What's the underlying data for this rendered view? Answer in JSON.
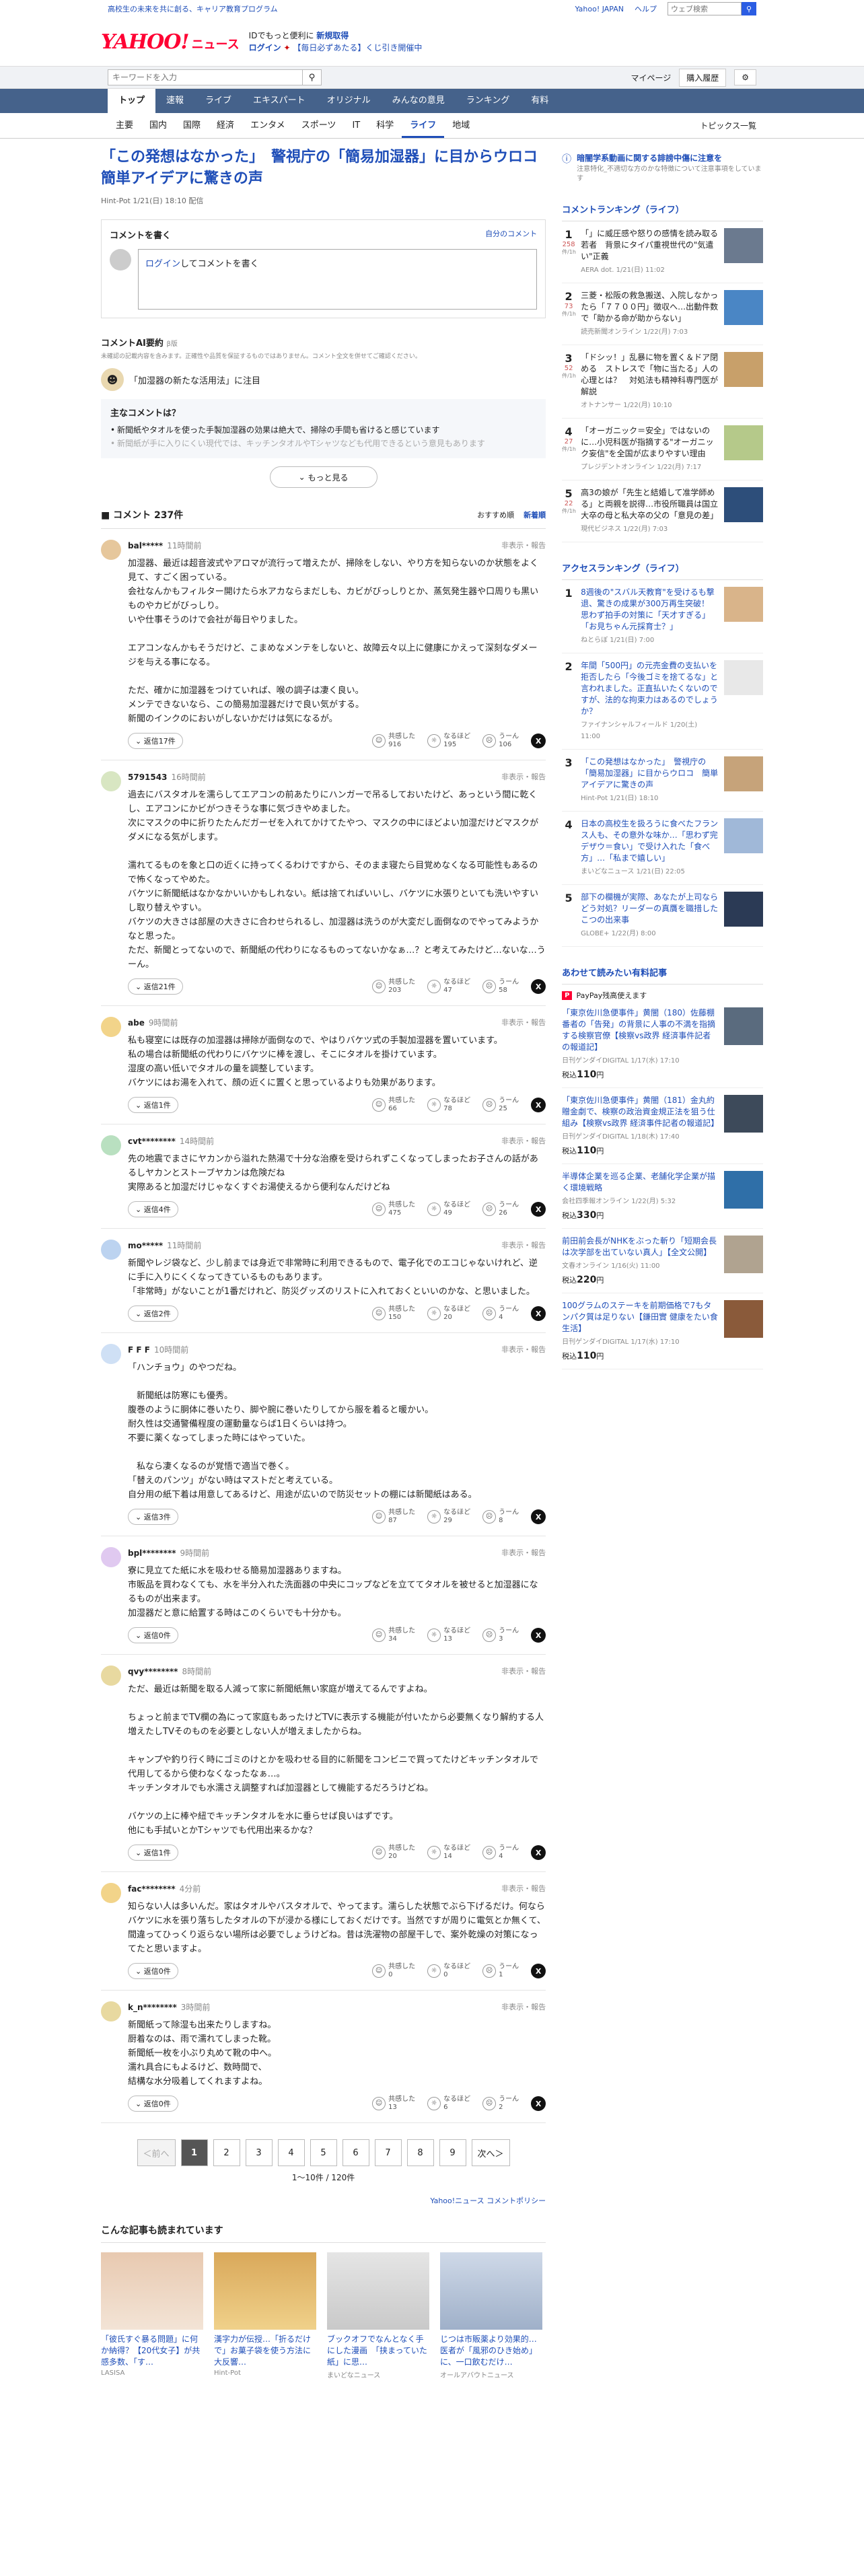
{
  "topstrip": {
    "left": "高校生の未来を共に創る、キャリア教育プログラム",
    "links": [
      "Yahoo! JAPAN",
      "ヘルプ"
    ],
    "search_placeholder": "ウェブ検索"
  },
  "brand": {
    "logo": "YAHOO!",
    "logo_sub": "JAPAN",
    "service": "ニュース",
    "promo1a": "IDでもっと便利に",
    "promo1b": "新規取得",
    "promo2a": "ログイン",
    "promo2b": "【毎日必ずあたる】くじ引き開催中"
  },
  "searchrow": {
    "placeholder": "キーワードを入力",
    "links": [
      "マイページ",
      "購入履歴"
    ]
  },
  "gnav": [
    "トップ",
    "速報",
    "ライブ",
    "エキスパート",
    "オリジナル",
    "みんなの意見",
    "ランキング",
    "有料"
  ],
  "snav": [
    "主要",
    "国内",
    "国際",
    "経済",
    "エンタメ",
    "スポーツ",
    "IT",
    "科学",
    "ライフ",
    "地域"
  ],
  "snav_right": "トピックス一覧",
  "article": {
    "title": "「この発想はなかった」　警視庁の「簡易加湿器」に目からウロコ　簡単アイデアに驚きの声",
    "source": "Hint-Pot",
    "date": "1/21(日) 18:10",
    "date_note": "配信"
  },
  "comment_box": {
    "title": "コメントを書く",
    "policy": "自分のコメント",
    "login": "ログイン",
    "placeholder": "してコメントを書く"
  },
  "ai": {
    "title": "コメントAI要約",
    "badge": "β版",
    "note": "未確認の記載内容を含みます。正確性や品質を保証するものではありません。コメント全文を併せてご確認ください。",
    "tag": "「加湿器の新たな活用法」に注目",
    "q": "主なコメントは？",
    "points": [
      "新聞紙やタオルを使った手製加湿器の効果は絶大で、掃除の手間も省けると感じています",
      "新聞紙が手に入りにくい現代では、キッチンタオルやTシャツなども代用できるという意見もあります"
    ],
    "more": "もっと見る"
  },
  "comments_header": {
    "title": "コメント 237件",
    "sort": [
      "おすすめ順",
      "新着順"
    ]
  },
  "comments": [
    {
      "user": "bal*****",
      "time": "11時間前",
      "report": "非表示・報告",
      "text": "加湿器、最近は超音波式やアロマが流行って増えたが、掃除をしない、やり方を知らないのか状態をよく見て、すごく困っている。\n会社なんかもフィルター開けたら水アカならまだしも、カビがびっしりとか、蒸気発生器や口周りも黒いものやカビがびっしり。\nいや仕事そうのけで会社が毎日やりました。\n\nエアコンなんかもそうだけど、こまめなメンテをしないと、故障云々以上に健康にかえって深刻なダメージを与える事になる。\n\nただ、確かに加湿器をつけていれば、喉の調子は凄く良い。\nメンテできないなら、この簡易加湿器だけで良い気がする。\n新聞のインクのにおいがしないかだけは気になるが。",
      "replies": "返信17件",
      "r1": "916",
      "r2": "195",
      "r3": "106"
    },
    {
      "user": "5791543",
      "time": "16時間前",
      "report": "非表示・報告",
      "text": "過去にバスタオルを濡らしてエアコンの前あたりにハンガーで吊るしておいたけど、あっという間に乾くし、エアコンにかビがつきそうな事に気づきやめました。\n次にマスクの中に折りたたんだガーゼを入れてかけてたやつ、マスクの中にほどよい加湿だけどマスクがダメになる気がします。\n\n濡れてるものを象と口の近くに持ってくるわけですから、そのまま寝たら目覚めなくなる可能性もあるので怖くなってやめた。\nバケツに新聞紙はなかなかいいかもしれない。紙は捨てればいいし、バケツに水張りといても洗いやすいし取り替えやすい。\nバケツの大きさは部屋の大きさに合わせられるし、加湿器は洗うのが大変だし面倒なのでやってみようかなと思った。\nただ、新聞とってないので、新聞紙の代わりになるものってないかなぁ…？と考えてみたけど…ないな…うーん。",
      "replies": "返信21件",
      "r1": "203",
      "r2": "47",
      "r3": "58"
    },
    {
      "user": "abe",
      "time": "9時間前",
      "report": "非表示・報告",
      "text": "私も寝室には既存の加湿器は掃除が面倒なので、やはりバケツ式の手製加湿器を置いています。\n私の場合は新聞紙の代わりにバケツに棒を渡し、そこにタオルを掛けています。\n湿度の高い低いでタオルの量を調整しています。\nバケツにはお湯を入れて、顔の近くに置くと思っているよりも効果があります。",
      "replies": "返信1件",
      "r1": "66",
      "r2": "78",
      "r3": "25"
    },
    {
      "user": "cvt********",
      "time": "14時間前",
      "report": "非表示・報告",
      "text": "先の地震でまさにヤカンから溢れた熱湯で十分な治療を受けられずこくなってしまったお子さんの話があるしヤカンとストーブヤカンは危険だね\n実際あると加湿だけじゃなくすぐお湯使えるから便利なんだけどね",
      "replies": "返信4件",
      "r1": "475",
      "r2": "49",
      "r3": "26"
    },
    {
      "user": "mo*****",
      "time": "11時間前",
      "report": "非表示・報告",
      "text": "新聞やレジ袋など、少し前までは身近で非常時に利用できるもので、電子化でのエコじゃないけれど、逆に手に入りにくくなってきているものもあります。\n「非常時」がないことが1番だけれど、防災グッズのリストに入れておくといいのかな、と思いました。",
      "replies": "返信2件",
      "r1": "150",
      "r2": "20",
      "r3": "4"
    },
    {
      "user": "F F F",
      "time": "10時間前",
      "report": "非表示・報告",
      "text": "「ハンチョウ」のやつだね。\n\n　新聞紙は防寒にも優秀。\n腹巻のように胴体に巻いたり、脚や腕に巻いたりしてから服を着ると暖かい。\n耐久性は交通警備程度の運動量ならば1日くらいは持つ。\n不要に薬くなってしまった時にはやっていた。\n\n　私なら凄くなるのが覚悟で適当で巻く。\n「替えのパンツ」がない時はマストだと考えている。\n自分用の紙下着は用意してあるけど、用途が広いので防災セットの棚には新聞紙はある。",
      "replies": "返信3件",
      "r1": "87",
      "r2": "29",
      "r3": "8"
    },
    {
      "user": "bpl********",
      "time": "9時間前",
      "report": "非表示・報告",
      "text": "寮に見立てた紙に水を吸わせる簡易加湿器ありますね。\n市販品を買わなくても、水を半分入れた洗面器の中央にコップなどを立ててタオルを被せると加湿器になるものが出来ます。\n加湿器だと意に給置する時はこのくらいでも十分かも。",
      "replies": "返信0件",
      "r1": "34",
      "r2": "13",
      "r3": "3"
    },
    {
      "user": "qvy********",
      "time": "8時間前",
      "report": "非表示・報告",
      "text": "ただ、最近は新聞を取る人減って家に新聞紙無い家庭が増えてるんですよね。\n\nちょっと前までTV欄の為にって家庭もあったけどTVに表示する機能が付いたから必要無くなり解約する人増えたしTVそのものを必要としない人が増えましたからね。\n\nキャンプや釣り行く時にゴミのけとかを吸わせる目的に新聞をコンビニで買ってたけどキッチンタオルで代用してるから使わなくなったなぁ…。\nキッチンタオルでも水濡さえ調整すれば加湿器として機能するだろうけどね。\n\nバケツの上に棒や紐でキッチンタオルを水に垂らせば良いはずです。\n他にも手拭いとかTシャツでも代用出来るかな？",
      "replies": "返信1件",
      "r1": "20",
      "r2": "14",
      "r3": "4"
    },
    {
      "user": "fac********",
      "time": "4分前",
      "report": "非表示・報告",
      "text": "知らない人は多いんだ。家はタオルやバスタオルで、やってます。濡らした状態でぶら下げるだけ。何ならバケツに水を張り落ちしたタオルの下が浸かる様にしておくだけです。当然ですが周りに電気とか無くて、間違ってひっくり返らない場所は必要でしょうけどね。昔は洗濯物の部屋干しで、案外乾燥の対策になってたと思いますよ。",
      "replies": "返信0件",
      "r1": "0",
      "r2": "0",
      "r3": "1"
    },
    {
      "user": "k_n********",
      "time": "3時間前",
      "report": "非表示・報告",
      "text": "新聞紙って除湿も出来たりしますね。\n厨着なのは、雨で濡れてしまった靴。\n新聞紙一枚を小ぶり丸めて靴の中へ。\n濡れ具合にもよるけど、数時間で、\n結構な水分吸着してくれますよね。",
      "replies": "返信0件",
      "r1": "13",
      "r2": "6",
      "r3": "2"
    }
  ],
  "pager": {
    "prev": "＜前へ",
    "pages": [
      "1",
      "2",
      "3",
      "4",
      "5",
      "6",
      "7",
      "8",
      "9"
    ],
    "next": "次へ＞",
    "count": "1〜10件 / 120件"
  },
  "policy_link": "Yahoo!ニュース コメントポリシー",
  "recos": {
    "title": "こんな記事も読まれています",
    "items": [
      {
        "cap": "「彼氏すぐ暴る問題」に何か納得？【20代女子】が共感多数、「す…",
        "src": "LASISA"
      },
      {
        "cap": "漢字力が伝授…「折るだけで」お菓子袋を使う方法に大反響…",
        "src": "Hint-Pot"
      },
      {
        "cap": "ブックオフでなんとなく手にした漫画　「挟まっていた紙」に思…",
        "src": "まいどなニュース"
      },
      {
        "cap": "じつは市販薬より効果的…医者が「風邪のひき始め」に、一口飲むだけ…",
        "src": "オールアバウトニュース"
      }
    ]
  },
  "side": {
    "notice_title": "暗闇学系動画に関する誹謗中傷に注意を",
    "notice_sub": "注意特化_不適切な方のかな特徴について注意事項をしています",
    "rank_title": "コメントランキング（ライフ）",
    "ranks": [
      {
        "n": "1",
        "c": "258",
        "c2": "件/1h",
        "t": "「」に威圧感や怒りの感情を読み取る若者　背景にタイパ重視世代の\"気遣い\"正義",
        "s": "AERA dot. 1/21(日) 11:02"
      },
      {
        "n": "2",
        "c": "73",
        "c2": "件/1h",
        "t": "三菱・松阪の救急搬送、入院しなかったら「７７００円」徴収へ…出動件数で「助かる命が助からない」",
        "s": "読売新聞オンライン 1/22(月) 7:03"
      },
      {
        "n": "3",
        "c": "52",
        "c2": "件/1h",
        "t": "「ドシッ！」乱暴に物を置く＆ドア閉める　ストレスで「物に当たる」人の心理とは？　対処法も精神科専門医が解説",
        "s": "オトナンサー 1/22(月) 10:10"
      },
      {
        "n": "4",
        "c": "27",
        "c2": "件/1h",
        "t": "「オーガニック＝安全」ではないのに…小児科医が指摘する\"オーガニック妄信\"を全国が広まりやすい理由",
        "s": "プレジデントオンライン 1/22(月) 7:17"
      },
      {
        "n": "5",
        "c": "22",
        "c2": "件/1h",
        "t": "高3の娘が「先生と結婚して准学師める」と両親を説得…市役所職員は国立大卒の母と私大卒の父の「意見の差」",
        "s": "現代ビジネス 1/22(月) 7:03"
      }
    ],
    "access_title": "アクセスランキング（ライフ）",
    "access": [
      {
        "n": "1",
        "t": "8週後の\"スバル天教育\"を受けるも撃退、驚きの成果が300万再生突破！　思わず拍手の対策に「天才すぎる」「お見ちゃん元採育士？」",
        "s": "ねとらぼ 1/21(日) 7:00"
      },
      {
        "n": "2",
        "t": "年間「500円」の元売金費の支払いを拒否したら「今後ゴミを捨てるな」と言われました。正直払いたくないのですが、法的な拘束力はあるのでしょうか？",
        "s": "ファイナンシャルフィールド 1/20(土) 11:00"
      },
      {
        "n": "3",
        "t": "「この発想はなかった」　警視庁の「簡易加湿器」に目からウロコ　簡単アイデアに驚きの声",
        "s": "Hint-Pot 1/21(日) 18:10"
      },
      {
        "n": "4",
        "t": "日本の高校生を扱ろうに食べたフランス人も、その意外な味か…「思わず完デザウ＝食い」で受け入れた「食べ方」…「私まで嬉しい」",
        "s": "まいどなニュース 1/21(日) 22:05"
      },
      {
        "n": "5",
        "t": "部下の欄機が実際、あなたが上司ならどう対処？リーダーの真贋を職措したこつの出来事",
        "s": "GLOBE+ 1/22(月) 8:00"
      }
    ],
    "paid_title": "あわせて読みたい有料記事",
    "pp": "PayPay残高使えます",
    "paid": [
      {
        "t": "「東京佐川急便事件」黄闇（180）佐藤棚番者の「告発」の背景に人事の不満を指摘する検察官僚【検察vs政界 経済事件記者の報道記】",
        "s": "日刊ゲンダイDIGITAL 1/17(水) 17:10",
        "p": "110"
      },
      {
        "t": "「東京佐川急便事件」黄闇（181）金丸約贈金劇で、検察の政治資金規正法を狙う仕組み【検察vs政界 経済事件記者の報道記】",
        "s": "日刊ゲンダイDIGITAL 1/18(木) 17:40",
        "p": "110"
      },
      {
        "t": "半導体企業を巡る企業、老舗化学企業が描く環境戦略",
        "s": "会社四季報オンライン 1/22(月) 5:32",
        "p": "330"
      },
      {
        "t": "前田前会長がNHKをぶった斬り「短期会長は次学部を出ていない真人」【全文公開】",
        "s": "文春オンライン 1/16(火) 11:00",
        "p": "220"
      },
      {
        "t": "100グラムのステーキを前期価格で7もタンパク質は足りない【鎌田實 健康をたい食生活】",
        "s": "日刊ゲンダイDIGITAL 1/17(水) 17:10",
        "p": "110"
      }
    ],
    "price_prefix": "税込",
    "price_suffix": "円"
  },
  "react_labels": {
    "r1": "共感した",
    "r2": "なるほど",
    "r3": "うーん"
  }
}
